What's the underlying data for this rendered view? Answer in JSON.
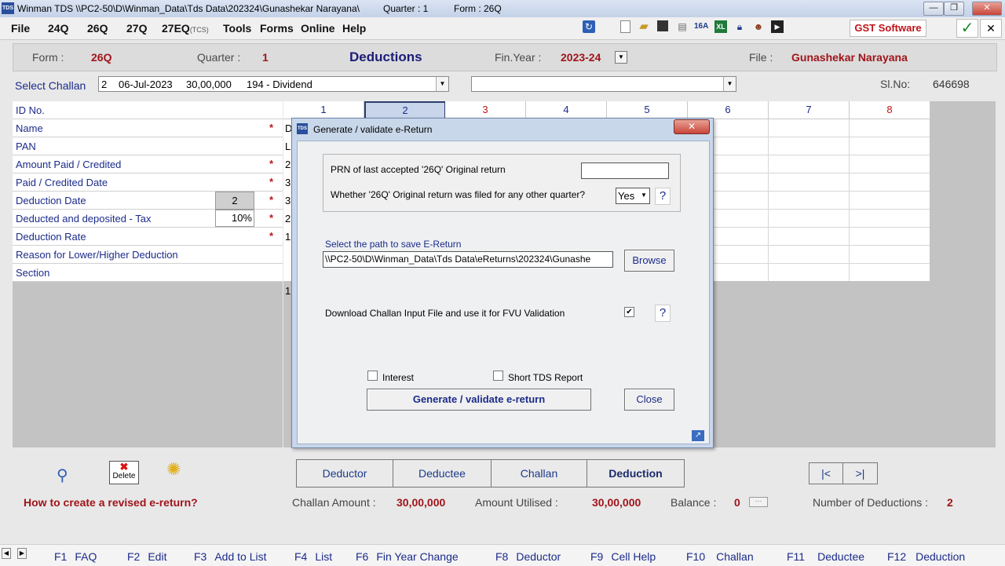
{
  "titlebar": {
    "icon": "TDS",
    "title": "Winman TDS \\\\PC2-50\\D\\Winman_Data\\Tds Data\\202324\\Gunashekar Narayana\\",
    "quarter": "Quarter : 1",
    "form": "Form : 26Q",
    "minimize": "—",
    "restore": "❐",
    "close": "✕"
  },
  "menu": {
    "items": [
      {
        "label": "File"
      },
      {
        "label": "24Q"
      },
      {
        "label": "26Q"
      },
      {
        "label": "27Q"
      },
      {
        "label": "27EQ"
      },
      {
        "label": "Tools"
      },
      {
        "label": "Forms"
      },
      {
        "label": "Online"
      },
      {
        "label": "Help"
      }
    ],
    "tcs_suffix": "(TCS)",
    "gst_button": "GST Software",
    "check": "✓",
    "close_child": "✕",
    "toolbar_16a": "16A",
    "toolbar_xl": "XL"
  },
  "header": {
    "form_label": "Form :",
    "form_value": "26Q",
    "quarter_label": "Quarter :",
    "quarter_value": "1",
    "title": "Deductions",
    "finyear_label": "Fin.Year :",
    "finyear_value": "2023-24",
    "file_label": "File :",
    "file_value": "Gunashekar Narayana"
  },
  "challan": {
    "label": "Select Challan",
    "selected_no": "2",
    "selected_date": "06-Jul-2023",
    "selected_amount": "30,00,000",
    "selected_section": "194 - Dividend",
    "second_value": "",
    "slno_label": "Sl.No:",
    "slno_value": "646698"
  },
  "grid": {
    "rows": [
      {
        "label": "ID No.",
        "required": ""
      },
      {
        "label": "Name",
        "required": "*"
      },
      {
        "label": "PAN",
        "required": ""
      },
      {
        "label": "Amount Paid / Credited",
        "required": "*"
      },
      {
        "label": "Paid / Credited Date",
        "required": "*"
      },
      {
        "label": "Deduction Date",
        "required": "*"
      },
      {
        "label": "Deducted and deposited - Tax",
        "required": "*"
      },
      {
        "label": "Deduction Rate",
        "required": "*"
      },
      {
        "label": "Reason for Lower/Higher Deduction",
        "required": ""
      },
      {
        "label": "Section",
        "required": ""
      }
    ],
    "deduction_date_box": "2",
    "tax_rate_box": "10%",
    "columns": [
      "1",
      "2",
      "3",
      "4",
      "5",
      "6",
      "7",
      "8"
    ],
    "col1_fragments": [
      "D",
      "L",
      "2",
      "3",
      "3",
      "2",
      "1",
      "",
      "1"
    ]
  },
  "dialog": {
    "title": "Generate / validate e-Return",
    "close": "✕",
    "prn_label": "PRN of last accepted '26Q' Original return",
    "prn_value": "",
    "other_quarter_label": "Whether '26Q' Original return was filed for any other quarter?",
    "other_quarter_value": "Yes",
    "help": "?",
    "path_label": "Select the path to save E-Return",
    "path_value": "\\\\PC2-50\\D\\Winman_Data\\Tds Data\\eReturns\\202324\\Gunashe",
    "browse": "Browse",
    "download_label": "Download Challan Input File and use it for FVU Validation",
    "download_checked": "✔",
    "interest_label": "Interest",
    "short_tds_label": "Short TDS Report",
    "generate_button": "Generate / validate e-return",
    "close_button": "Close"
  },
  "bottom": {
    "delete_label": "Delete",
    "help_link": "How to create a revised e-return?",
    "nav": [
      "Deductor",
      "Deductee",
      "Challan",
      "Deduction"
    ],
    "first": "|<",
    "last": ">|",
    "challan_amount_label": "Challan Amount :",
    "challan_amount_value": "30,00,000",
    "amount_utilised_label": "Amount Utilised :",
    "amount_utilised_value": "30,00,000",
    "balance_label": "Balance :",
    "balance_value": "0",
    "balance_more": "···",
    "num_deductions_label": "Number of Deductions :",
    "num_deductions_value": "2"
  },
  "fkeys": [
    {
      "key": "F1",
      "label": "FAQ"
    },
    {
      "key": "F2",
      "label": "Edit"
    },
    {
      "key": "F3",
      "label": "Add to List"
    },
    {
      "key": "F4",
      "label": "List"
    },
    {
      "key": "F6",
      "label": "Fin Year Change"
    },
    {
      "key": "F8",
      "label": "Deductor"
    },
    {
      "key": "F9",
      "label": "Cell Help"
    },
    {
      "key": "F10",
      "label": "Challan"
    },
    {
      "key": "F11",
      "label": "Deductee"
    },
    {
      "key": "F12",
      "label": "Deduction"
    }
  ],
  "colors": {
    "accent_red": "#a0141a",
    "label_blue": "#1c2b8a"
  }
}
